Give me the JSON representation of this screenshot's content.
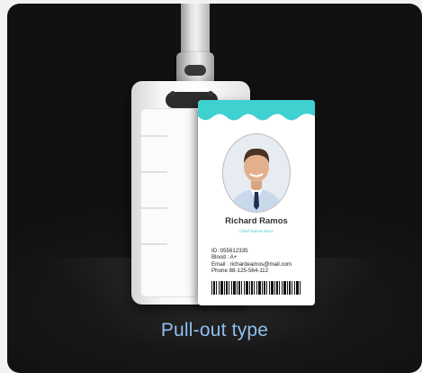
{
  "caption": "Pull-out type",
  "id_card": {
    "name": "Richard Ramos",
    "job_title": "Chief Games Boss",
    "id_line": "ID      :055612335",
    "blood_line": "Blood : A+",
    "email_line": "Email : richardeamos@mail.com",
    "phone_line": "Phone 88-125-564-112",
    "accent_color": "#3fd0d0"
  }
}
